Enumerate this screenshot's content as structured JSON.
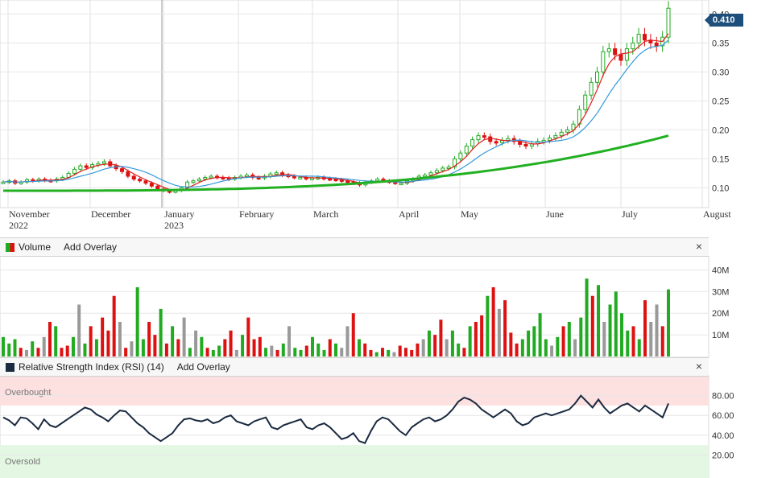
{
  "price_panel": {
    "y_ticks": [
      "0.10",
      "0.15",
      "0.20",
      "0.25",
      "0.30",
      "0.35",
      "0.40"
    ],
    "last_price_label": "0.410",
    "months": [
      {
        "label": "November",
        "sub": "2022"
      },
      {
        "label": "December",
        "sub": ""
      },
      {
        "label": "January",
        "sub": "2023"
      },
      {
        "label": "February",
        "sub": ""
      },
      {
        "label": "March",
        "sub": ""
      },
      {
        "label": "April",
        "sub": ""
      },
      {
        "label": "May",
        "sub": ""
      },
      {
        "label": "June",
        "sub": ""
      },
      {
        "label": "July",
        "sub": ""
      },
      {
        "label": "August",
        "sub": ""
      }
    ]
  },
  "volume_panel": {
    "title": "Volume",
    "add_overlay": "Add Overlay",
    "close": "×",
    "y_ticks": [
      "10M",
      "20M",
      "30M",
      "40M"
    ]
  },
  "rsi_panel": {
    "title": "Relative Strength Index (RSI) (14)",
    "add_overlay": "Add Overlay",
    "close": "×",
    "overbought_label": "Overbought",
    "oversold_label": "Oversold",
    "y_ticks": [
      "20.00",
      "40.00",
      "60.00",
      "80.00"
    ]
  },
  "colors": {
    "up": "#22aa22",
    "down": "#dd1111",
    "neutral": "#999999",
    "ma_short": "#e02020",
    "ma_mid": "#3399dd",
    "ma_long": "#22b022",
    "rsi": "#1a2a40",
    "overbought_band": "#fde0e0",
    "oversold_band": "#e3f7e3"
  },
  "chart_data": [
    {
      "type": "candlestick",
      "x_start": "2022-10-24",
      "x_end": "2023-07-27",
      "ylim": [
        0.07,
        0.42
      ],
      "close_series": [
        0.11,
        0.112,
        0.108,
        0.11,
        0.114,
        0.112,
        0.115,
        0.113,
        0.112,
        0.115,
        0.118,
        0.125,
        0.132,
        0.138,
        0.135,
        0.14,
        0.142,
        0.145,
        0.138,
        0.133,
        0.128,
        0.12,
        0.115,
        0.112,
        0.108,
        0.103,
        0.098,
        0.095,
        0.093,
        0.095,
        0.1,
        0.11,
        0.112,
        0.115,
        0.118,
        0.12,
        0.118,
        0.117,
        0.115,
        0.118,
        0.12,
        0.122,
        0.118,
        0.117,
        0.12,
        0.124,
        0.126,
        0.122,
        0.12,
        0.118,
        0.118,
        0.116,
        0.117,
        0.118,
        0.116,
        0.115,
        0.114,
        0.112,
        0.11,
        0.108,
        0.105,
        0.11,
        0.112,
        0.115,
        0.112,
        0.11,
        0.108,
        0.108,
        0.112,
        0.115,
        0.12,
        0.122,
        0.126,
        0.13,
        0.134,
        0.136,
        0.15,
        0.16,
        0.172,
        0.183,
        0.19,
        0.188,
        0.18,
        0.178,
        0.182,
        0.185,
        0.18,
        0.175,
        0.172,
        0.176,
        0.18,
        0.182,
        0.186,
        0.19,
        0.196,
        0.2,
        0.21,
        0.235,
        0.26,
        0.282,
        0.3,
        0.335,
        0.34,
        0.33,
        0.32,
        0.34,
        0.35,
        0.365,
        0.355,
        0.35,
        0.345,
        0.36,
        0.41
      ],
      "ma_short_end": 0.36,
      "ma_mid_end": 0.32,
      "ma_long_end": 0.19,
      "ma_long_start": 0.095,
      "last": 0.41
    },
    {
      "type": "bar",
      "name": "Volume",
      "ylim": [
        0,
        45000000
      ],
      "values": [
        9,
        6,
        8,
        4,
        3,
        7,
        4,
        9,
        16,
        14,
        4,
        5,
        9,
        24,
        6,
        14,
        8,
        18,
        12,
        28,
        16,
        4,
        7,
        32,
        8,
        16,
        10,
        22,
        6,
        14,
        8,
        18,
        4,
        12,
        9,
        4,
        3,
        5,
        8,
        12,
        3,
        10,
        18,
        8,
        9,
        4,
        5,
        3,
        6,
        14,
        4,
        3,
        5,
        9,
        6,
        3,
        8,
        6,
        4,
        14,
        20,
        8,
        6,
        3,
        2,
        4,
        3,
        2,
        5,
        4,
        3,
        6,
        8,
        12,
        10,
        17,
        8,
        12,
        6,
        4,
        14,
        16,
        19,
        28,
        32,
        22,
        26,
        11,
        6,
        8,
        12,
        14,
        20,
        8,
        5,
        9,
        14,
        16,
        8,
        18,
        36,
        28,
        33,
        16,
        24,
        30,
        20,
        12,
        14,
        8,
        26,
        16,
        24,
        14,
        31
      ],
      "up_flags": "1110010101001110100010011001010010101100110001001011011101000100101100001100011010010100011111110101101011110101101"
    },
    {
      "type": "line",
      "name": "RSI",
      "ylim": [
        0,
        100
      ],
      "overbought": 70,
      "oversold": 30,
      "values": [
        58,
        55,
        50,
        58,
        57,
        52,
        46,
        56,
        50,
        48,
        52,
        56,
        60,
        64,
        68,
        66,
        61,
        58,
        54,
        60,
        65,
        64,
        58,
        52,
        48,
        42,
        38,
        34,
        38,
        42,
        50,
        56,
        57,
        55,
        54,
        56,
        52,
        54,
        58,
        60,
        54,
        52,
        50,
        54,
        56,
        58,
        48,
        46,
        50,
        52,
        54,
        56,
        48,
        46,
        50,
        52,
        48,
        42,
        36,
        38,
        42,
        34,
        32,
        44,
        54,
        58,
        56,
        50,
        44,
        40,
        48,
        52,
        56,
        58,
        54,
        56,
        60,
        66,
        74,
        78,
        76,
        72,
        66,
        62,
        58,
        62,
        66,
        62,
        54,
        50,
        52,
        58,
        60,
        62,
        60,
        62,
        64,
        66,
        72,
        80,
        74,
        68,
        76,
        68,
        62,
        66,
        70,
        72,
        68,
        64,
        70,
        66,
        62,
        58,
        72
      ]
    }
  ]
}
